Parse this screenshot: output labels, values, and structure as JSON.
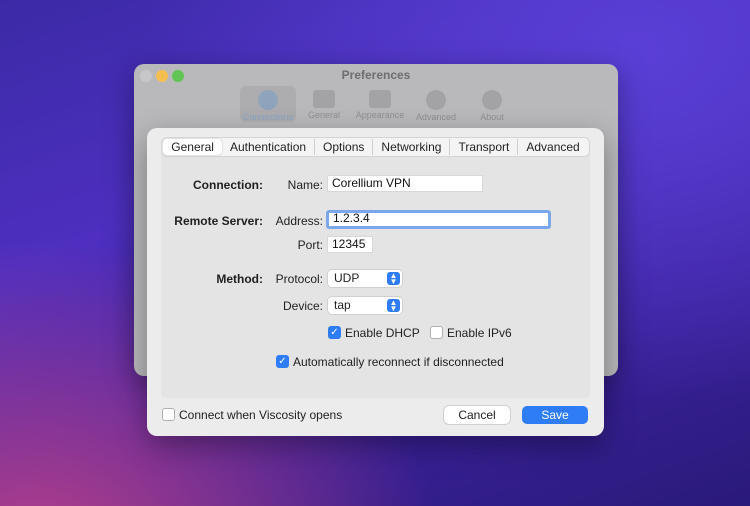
{
  "background_window": {
    "title": "Preferences",
    "toolbar": [
      {
        "label": "Connections",
        "icon": "globe-icon"
      },
      {
        "label": "General",
        "icon": "window-icon"
      },
      {
        "label": "Appearance",
        "icon": "monitor-icon"
      },
      {
        "label": "Advanced",
        "icon": "gear-icon"
      },
      {
        "label": "About",
        "icon": "info-icon"
      }
    ]
  },
  "tabs": [
    "General",
    "Authentication",
    "Options",
    "Networking",
    "Transport",
    "Advanced"
  ],
  "active_tab": "General",
  "form": {
    "connection_section": "Connection:",
    "name_label": "Name:",
    "name_value": "Corellium VPN",
    "remote_server_section": "Remote Server:",
    "address_label": "Address:",
    "address_value": "1.2.3.4",
    "port_label": "Port:",
    "port_value": "12345",
    "method_section": "Method:",
    "protocol_label": "Protocol:",
    "protocol_value": "UDP",
    "device_label": "Device:",
    "device_value": "tap",
    "enable_dhcp_label": "Enable DHCP",
    "enable_dhcp_checked": true,
    "enable_ipv6_label": "Enable IPv6",
    "enable_ipv6_checked": false,
    "auto_reconnect_label": "Automatically reconnect if disconnected",
    "auto_reconnect_checked": true
  },
  "footer": {
    "connect_on_open_label": "Connect when Viscosity opens",
    "connect_on_open_checked": false,
    "cancel_label": "Cancel",
    "save_label": "Save"
  },
  "colors": {
    "accent": "#2e7cf6",
    "focus_ring": "#7aa7e9"
  }
}
